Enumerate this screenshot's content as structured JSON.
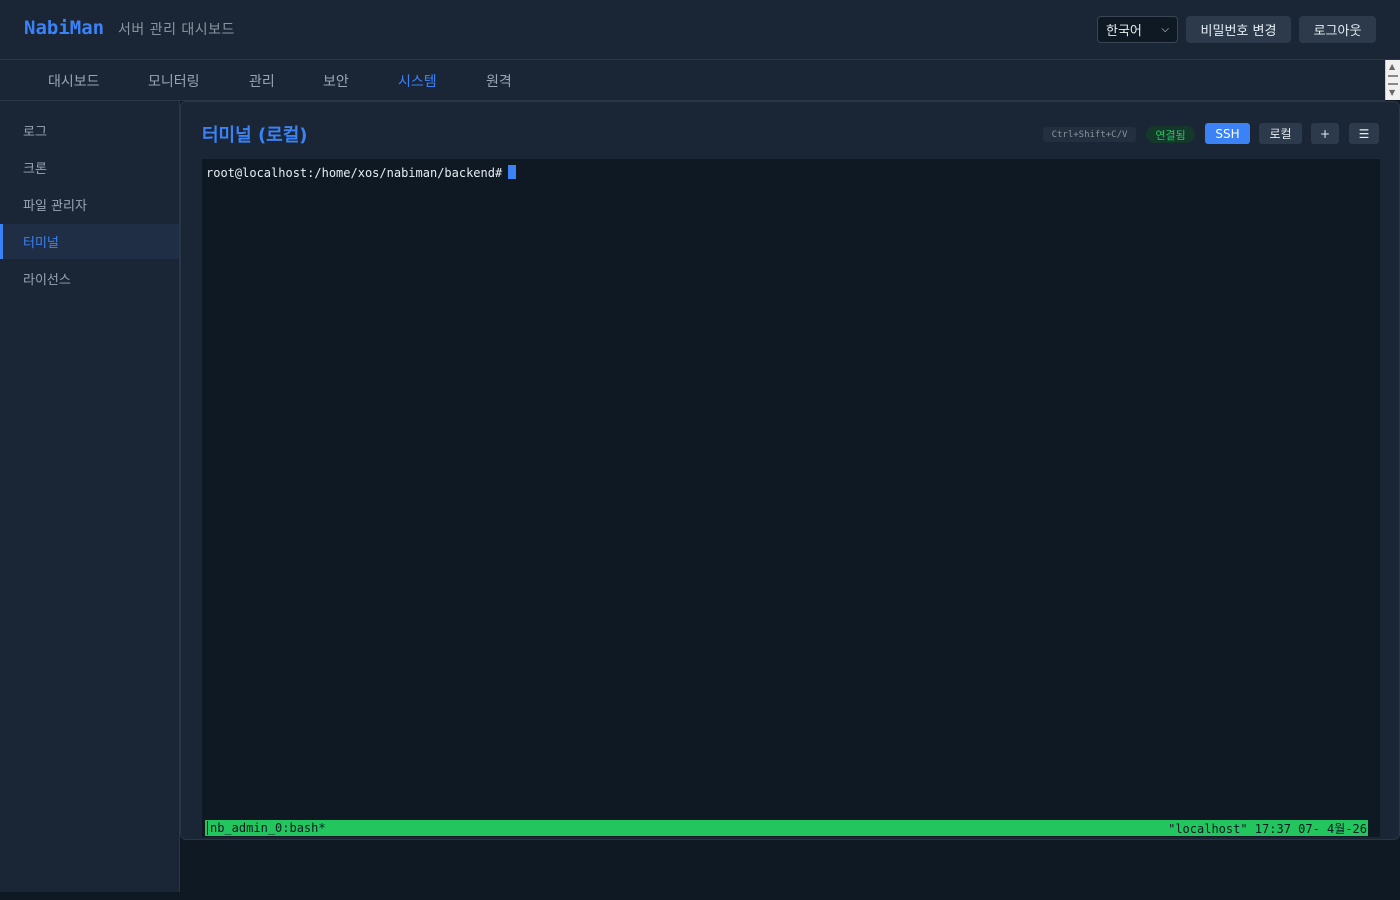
{
  "header": {
    "logo": "NabiMan",
    "subtitle": "서버 관리 대시보드",
    "language": "한국어",
    "change_password": "비밀번호 변경",
    "logout": "로그아웃"
  },
  "nav": {
    "tabs": [
      {
        "label": "대시보드"
      },
      {
        "label": "모니터링"
      },
      {
        "label": "관리"
      },
      {
        "label": "보안"
      },
      {
        "label": "시스템"
      },
      {
        "label": "원격"
      }
    ],
    "active": "시스템"
  },
  "sidebar": {
    "items": [
      {
        "label": "로그"
      },
      {
        "label": "크론"
      },
      {
        "label": "파일 관리자"
      },
      {
        "label": "터미널"
      },
      {
        "label": "라이선스"
      }
    ],
    "active": "터미널"
  },
  "terminal": {
    "title": "터미널 (로컬)",
    "shortcut_hint": "Ctrl+Shift+C/V",
    "status": "연결됨",
    "ssh_label": "SSH",
    "local_label": "로컬",
    "add_label": "+",
    "menu_label": "☰",
    "prompt": "root@localhost:/home/xos/nabiman/backend#",
    "tmux_left": "nb_admin_0:bash*",
    "tmux_right": "\"localhost\" 17:37 07- 4월-26"
  },
  "colors": {
    "accent": "#3b82f6",
    "success": "#22c55e",
    "background": "#0f1923",
    "surface": "#1a2636"
  }
}
